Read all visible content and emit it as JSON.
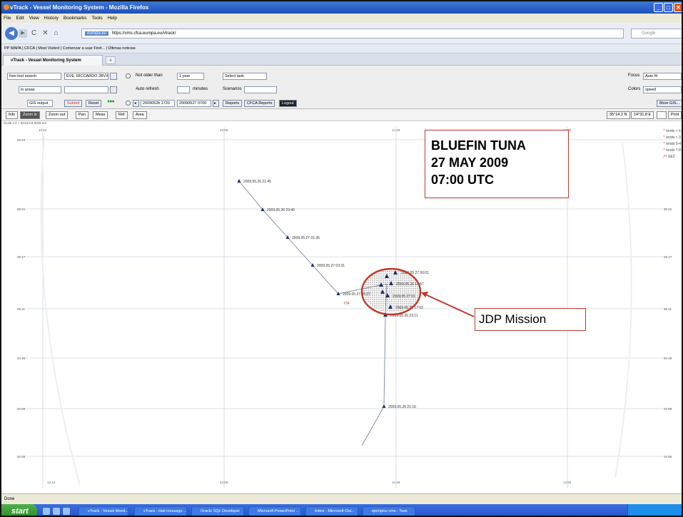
{
  "window": {
    "title": "vTrack - Vessel Monitoring System - Mozilla Firefox"
  },
  "menu": [
    "File",
    "Edit",
    "View",
    "History",
    "Bookmarks",
    "Tools",
    "Help"
  ],
  "nav": {
    "site_badge": "europa.eu",
    "url": "https://vms.cfca.europa.eu/vtrack/",
    "search_placeholder": "Google"
  },
  "bookmarks": "PP MAPA | CFCA | Most Visited | Comenzar a usar Firef... | Últimas noticias",
  "tab": {
    "label": "vTrack - Vessel Monitoring System"
  },
  "app": {
    "search_mode": "free-text search",
    "vessel": "EVE, RICCARDO JRVX",
    "area_mode": "in areas",
    "gis_output": "GIS output",
    "submit": "Submit",
    "reset": "Reset",
    "not_older_label": "Not older than",
    "not_older_value": "1 year",
    "auto_refresh_label": "Auto refresh",
    "minutes_label": "minutes",
    "date_from": "2009052k 1720",
    "date_to": "20090527 0700",
    "select_task": "Select task",
    "scenarios_label": "Scenarios",
    "reports": "Reports",
    "cfca_reports": "CFCA Reports",
    "logout": "Logout",
    "focus_label": "Focus",
    "focus_value": "Auto fit",
    "colors_label": "Colors",
    "colors_value": "speed",
    "more_gis": "More GIS..."
  },
  "toolbar": {
    "buttons": [
      "Info",
      "Zoom in",
      "Zoom out",
      "Pan",
      "Meas",
      "Ref",
      "Area"
    ],
    "coord_lat": "35°14.2 N",
    "coord_lon": "14°31.8 E",
    "print": "Print"
  },
  "map": {
    "scale": "Scale 1:0 + 5013.0.6 8328 nm",
    "positions": [
      "2009.05.26 21:45",
      "2009.05.26 23:40",
      "2009.05.27 01:36",
      "2009.05.27 03:31",
      "2009.05.27 05:27",
      "2009.05.27 06:01",
      "2009.05.26 14:57",
      "2009.05.27 01",
      "2009.05.26 17:03",
      "2009.05.26 23:11",
      "2009.05.26 21:16"
    ],
    "area_label": "ITA",
    "lat_labels": [
      "35 24",
      "35 21",
      "35 17",
      "35 11",
      "34 46",
      "34 59",
      "34 55"
    ],
    "lon_labels": [
      "13 44",
      "13 59",
      "14 49",
      "14 59"
    ],
    "legend": [
      "knots > 6",
      "knots < 3",
      "knots 3-4",
      "knots 7-8",
      "EEZ"
    ]
  },
  "annotations": {
    "headline": [
      "BLUEFIN TUNA",
      "27 MAY 2009",
      "07:00 UTC"
    ],
    "jdp": "JDP Mission"
  },
  "status": "Done",
  "taskbar": {
    "start": "start",
    "tasks": [
      "vTrack - Vessel Monit...",
      "vTrack - Hail message ...",
      "Oracle SQL Developer",
      "Microsoft PowerPoint ...",
      "Inbox - Microsoft Out...",
      "ejemplos vms - Task"
    ]
  },
  "colors": {
    "accent": "#c0392b",
    "vessel": "#1a2a6c"
  }
}
